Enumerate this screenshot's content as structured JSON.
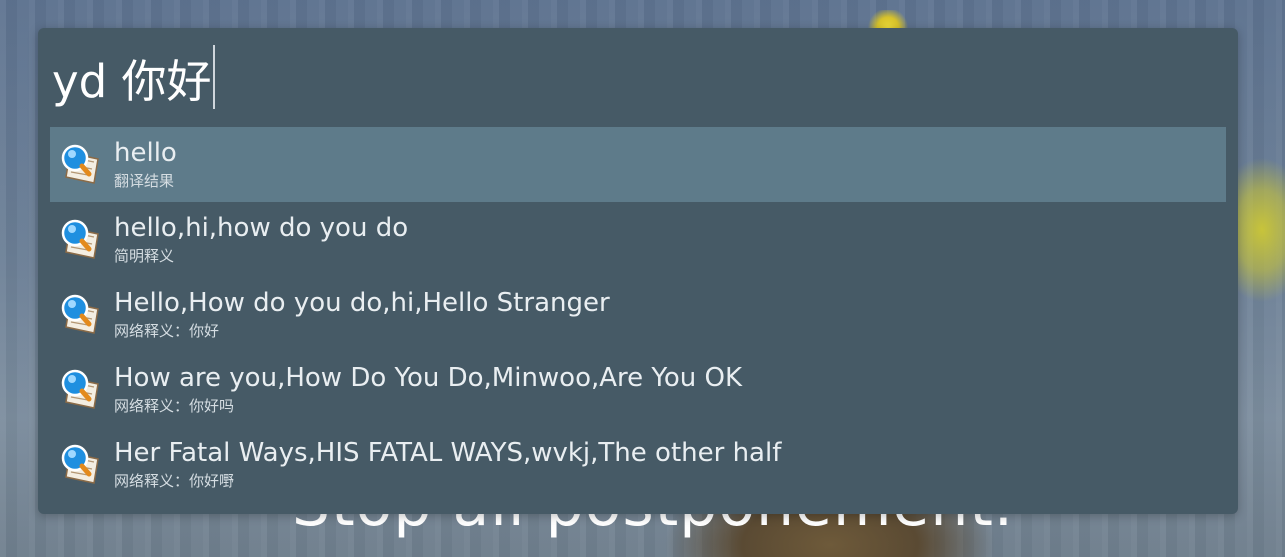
{
  "background": {
    "caption": "Stop all postponement."
  },
  "query": {
    "text": "yd 你好"
  },
  "results": [
    {
      "title": "hello",
      "subtitle": "翻译结果",
      "icon": "dictionary-search-icon",
      "selected": true
    },
    {
      "title": "hello,hi,how do you do",
      "subtitle": "简明释义",
      "icon": "dictionary-search-icon",
      "selected": false
    },
    {
      "title": "Hello,How do you do,hi,Hello Stranger",
      "subtitle": "网络释义：你好",
      "icon": "dictionary-search-icon",
      "selected": false
    },
    {
      "title": "How are you,How Do You Do,Minwoo,Are You OK",
      "subtitle": "网络释义：你好吗",
      "icon": "dictionary-search-icon",
      "selected": false
    },
    {
      "title": "Her Fatal Ways,HIS FATAL WAYS,wvkj,The other half",
      "subtitle": "网络释义：你好嘢",
      "icon": "dictionary-search-icon",
      "selected": false
    }
  ],
  "colors": {
    "panel": "#465a66",
    "selected": "#5e7b8a"
  }
}
